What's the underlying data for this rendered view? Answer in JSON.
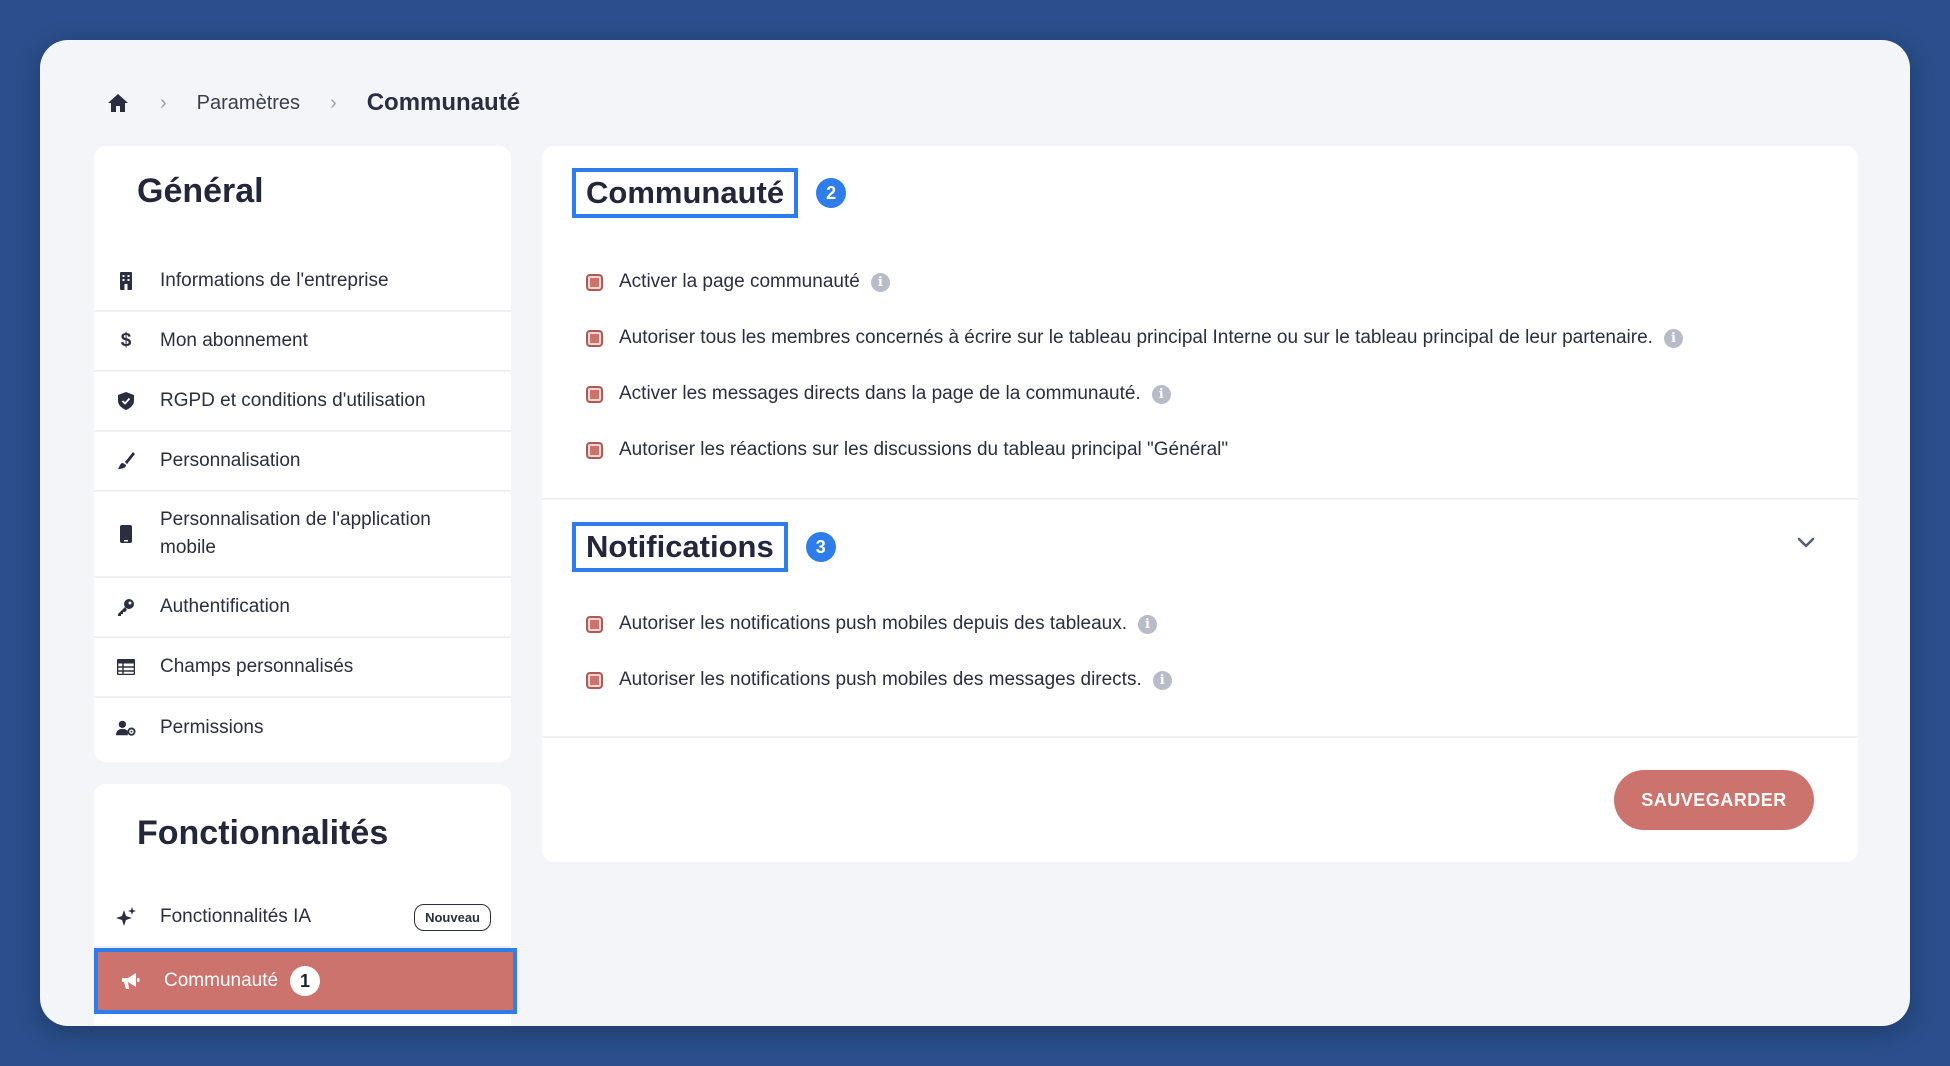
{
  "breadcrumb": {
    "home_icon": "home-icon",
    "parent": "Paramètres",
    "current": "Communauté"
  },
  "sidebar_general": {
    "title": "Général",
    "items": [
      {
        "label": "Informations de l'entreprise",
        "icon": "building-icon"
      },
      {
        "label": "Mon abonnement",
        "icon": "dollar-icon"
      },
      {
        "label": "RGPD et conditions d'utilisation",
        "icon": "shield-icon"
      },
      {
        "label": "Personnalisation",
        "icon": "brush-icon"
      },
      {
        "label": "Personnalisation de l'application mobile",
        "icon": "mobile-icon"
      },
      {
        "label": "Authentification",
        "icon": "key-icon"
      },
      {
        "label": "Champs personnalisés",
        "icon": "table-icon"
      },
      {
        "label": "Permissions",
        "icon": "user-gear-icon"
      }
    ]
  },
  "sidebar_features": {
    "title": "Fonctionnalités",
    "items": [
      {
        "label": "Fonctionnalités IA",
        "icon": "sparkles-icon",
        "badge": "Nouveau"
      },
      {
        "label": "Communauté",
        "icon": "megaphone-icon",
        "active": true,
        "step": "1"
      }
    ]
  },
  "main": {
    "community": {
      "title": "Communauté",
      "step": "2",
      "options": [
        {
          "label": "Activer la page communauté",
          "info": true
        },
        {
          "label": "Autoriser tous les membres concernés à écrire sur le tableau principal Interne ou sur le tableau principal de leur partenaire.",
          "info": true
        },
        {
          "label": "Activer les messages directs dans la page de la communauté.",
          "info": true
        },
        {
          "label": "Autoriser les réactions sur les discussions du tableau principal \"Général\"",
          "info": false
        }
      ]
    },
    "notifications": {
      "title": "Notifications",
      "step": "3",
      "options": [
        {
          "label": "Autoriser les notifications push mobiles depuis des tableaux.",
          "info": true
        },
        {
          "label": "Autoriser les notifications push mobiles des messages directs.",
          "info": true
        }
      ]
    },
    "save_label": "SAUVEGARDER"
  },
  "colors": {
    "background": "#2a4f8c",
    "accent": "#cd736d",
    "highlight": "#2f7dea",
    "text": "#2b2e40"
  }
}
